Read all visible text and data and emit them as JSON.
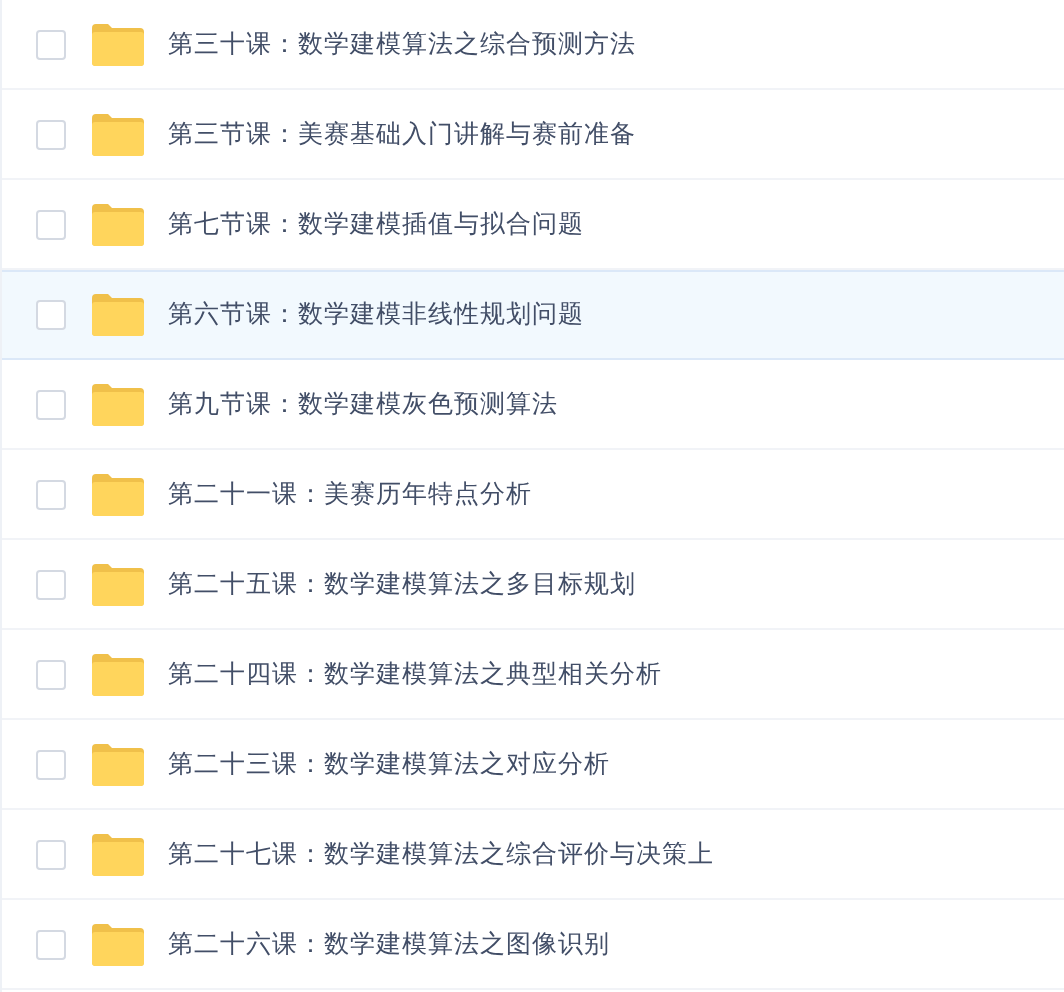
{
  "files": [
    {
      "name": "第三十课：数学建模算法之综合预测方法",
      "checked": false,
      "hovered": false
    },
    {
      "name": "第三节课：美赛基础入门讲解与赛前准备",
      "checked": false,
      "hovered": false
    },
    {
      "name": "第七节课：数学建模插值与拟合问题",
      "checked": false,
      "hovered": false
    },
    {
      "name": "第六节课：数学建模非线性规划问题",
      "checked": false,
      "hovered": true
    },
    {
      "name": "第九节课：数学建模灰色预测算法",
      "checked": false,
      "hovered": false
    },
    {
      "name": "第二十一课：美赛历年特点分析",
      "checked": false,
      "hovered": false
    },
    {
      "name": "第二十五课：数学建模算法之多目标规划",
      "checked": false,
      "hovered": false
    },
    {
      "name": "第二十四课：数学建模算法之典型相关分析",
      "checked": false,
      "hovered": false
    },
    {
      "name": "第二十三课：数学建模算法之对应分析",
      "checked": false,
      "hovered": false
    },
    {
      "name": "第二十七课：数学建模算法之综合评价与决策上",
      "checked": false,
      "hovered": false
    },
    {
      "name": "第二十六课：数学建模算法之图像识别",
      "checked": false,
      "hovered": false
    }
  ]
}
